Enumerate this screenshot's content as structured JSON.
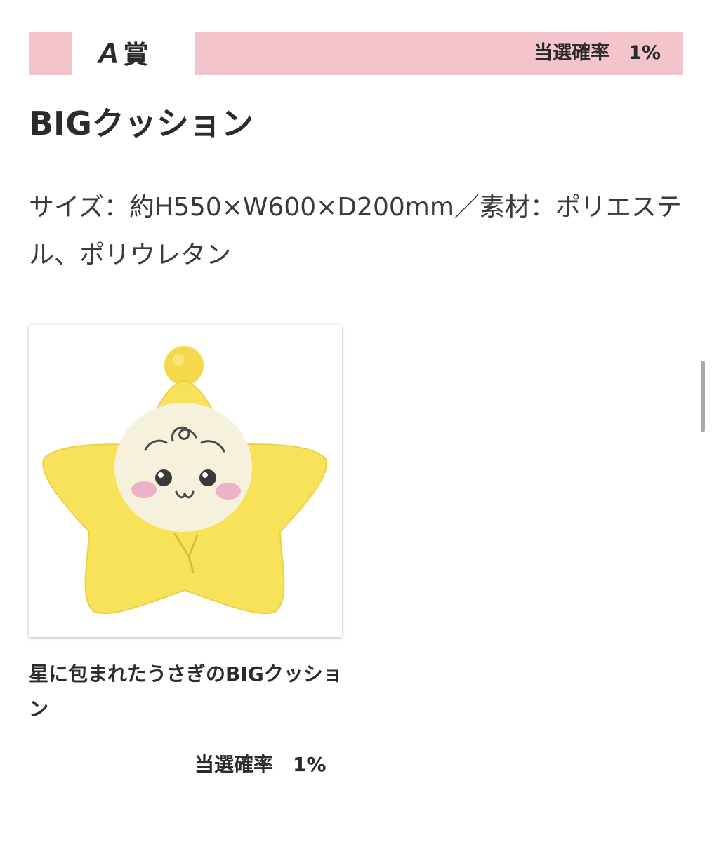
{
  "prize": {
    "grade_letter": "A",
    "grade_suffix": "賞",
    "probability": "当選確率　1%"
  },
  "item": {
    "title": "BIGクッション",
    "description": "サイズ：約H550×W600×D200mm／素材：ポリエステル、ポリウレタン"
  },
  "card": {
    "image_icon": "star-bunny-cushion",
    "caption": "星に包まれたうさぎのBIGクッション",
    "probability": "当選確率　1%"
  },
  "colors": {
    "accent_pink": "#f4c4cc",
    "text": "#2b2b2b",
    "star_yellow": "#f8e25a",
    "face_cream": "#f6f1dc",
    "cheek_pink": "#ebb2c8"
  }
}
